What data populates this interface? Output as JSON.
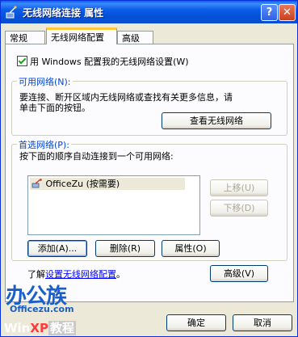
{
  "window": {
    "title": "无线网络连接 属性",
    "help_glyph": "?",
    "close_glyph": "✕",
    "title_icon": "network-connection-icon"
  },
  "tabs": [
    {
      "label": "常规",
      "selected": false
    },
    {
      "label": "无线网络配置",
      "selected": true
    },
    {
      "label": "高级",
      "selected": false
    }
  ],
  "use_windows_checkbox": {
    "label": "用 Windows 配置我的无线网络设置(W)",
    "checked": true
  },
  "available_group": {
    "legend": "可用网络(N):",
    "description_line1": "要连接、断开区域内无线网络或查找有关更多信息，请",
    "description_line2": "单击下面的按钮。",
    "view_button": "查看无线网络"
  },
  "preferred_group": {
    "legend": "首选网络(P):",
    "description": "按下面的顺序自动连接到一个可用网络:",
    "networks": [
      {
        "name": "OfficeZu (按需要)",
        "icon": "wireless-network-icon"
      }
    ],
    "move_up_button": "上移(U)",
    "move_down_button": "下移(D)",
    "add_button": "添加(A)...",
    "remove_button": "删除(R)",
    "properties_button": "属性(O)"
  },
  "learn_more": {
    "prefix": "了解",
    "link": "设置无线网络配置",
    "suffix": "。"
  },
  "advanced_button": "高级(V)",
  "footer_buttons": {
    "ok": "确定",
    "cancel": "取消"
  },
  "watermark": {
    "brand": "办公族",
    "site": "Officezu.com",
    "win": "Win",
    "xp": "XP",
    "tutorial": "教程"
  },
  "colors": {
    "titlebar": "#0a5ee8",
    "dialog_bg": "#ece9d8",
    "group_legend": "#0046d5",
    "link": "#0000ff",
    "brand_blue": "#1a5fc9"
  }
}
